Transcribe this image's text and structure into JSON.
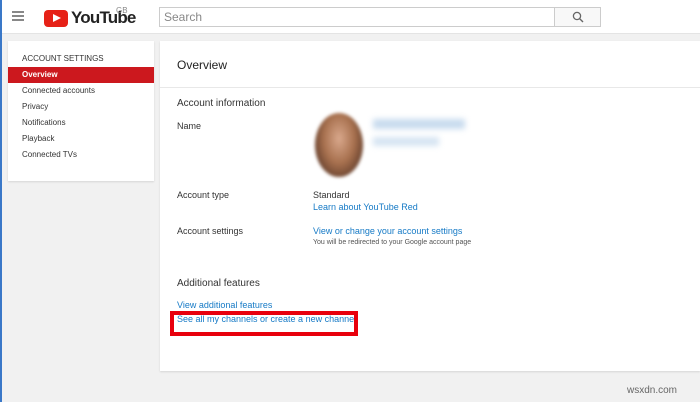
{
  "header": {
    "logo_text": "YouTube",
    "region": "GB",
    "search_placeholder": "Search"
  },
  "sidebar": {
    "heading": "ACCOUNT SETTINGS",
    "items": [
      {
        "label": "Overview",
        "active": true
      },
      {
        "label": "Connected accounts"
      },
      {
        "label": "Privacy"
      },
      {
        "label": "Notifications"
      },
      {
        "label": "Playback"
      },
      {
        "label": "Connected TVs"
      }
    ]
  },
  "main": {
    "title": "Overview",
    "account_info": {
      "heading": "Account information",
      "name_label": "Name",
      "type_label": "Account type",
      "type_value": "Standard",
      "type_link": "Learn about YouTube Red",
      "settings_label": "Account settings",
      "settings_link": "View or change your account settings",
      "settings_note": "You will be redirected to your Google account page"
    },
    "additional": {
      "heading": "Additional features",
      "view_link": "View additional features",
      "channels_link": "See all my channels or create a new channel"
    }
  },
  "watermark": "wsxdn.com",
  "colors": {
    "brand_red": "#e62117",
    "active_nav": "#cc181e",
    "link": "#167ac6",
    "highlight_box": "#e8000d"
  }
}
